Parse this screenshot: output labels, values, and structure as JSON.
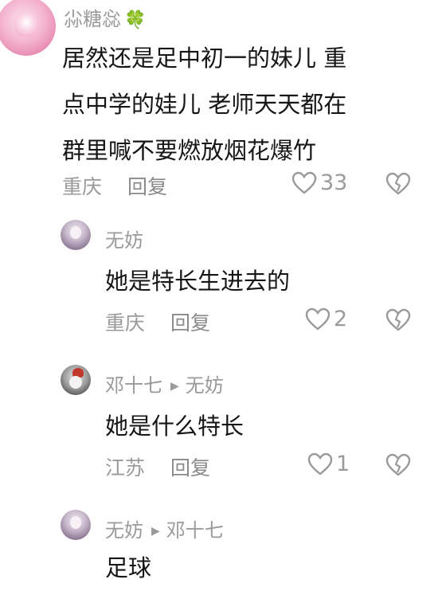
{
  "comments": [
    {
      "username": "尛糖惢",
      "badge": "🍀",
      "text_lines": [
        "居然还是足中初一的妹儿 重",
        "点中学的娃儿 老师天天都在",
        "群里喊不要燃放烟花爆竹"
      ],
      "location": "重庆",
      "reply_label": "回复",
      "likes": "33"
    },
    {
      "username": "无妨",
      "text_lines": [
        "她是特长生进去的"
      ],
      "location": "重庆",
      "reply_label": "回复",
      "likes": "2"
    },
    {
      "username": "邓十七",
      "reply_to": "无妨",
      "text_lines": [
        "她是什么特长"
      ],
      "location": "江苏",
      "reply_label": "回复",
      "likes": "1"
    },
    {
      "username": "无妨",
      "reply_to": "邓十七",
      "text_lines": [
        "足球"
      ]
    }
  ],
  "icons": {
    "heart": "heart-icon",
    "dislike": "broken-heart-icon",
    "reply_arrow": "triangle-right-icon"
  },
  "colors": {
    "background": "#ffffff",
    "text": "#161616",
    "muted": "#9a9a9a"
  }
}
